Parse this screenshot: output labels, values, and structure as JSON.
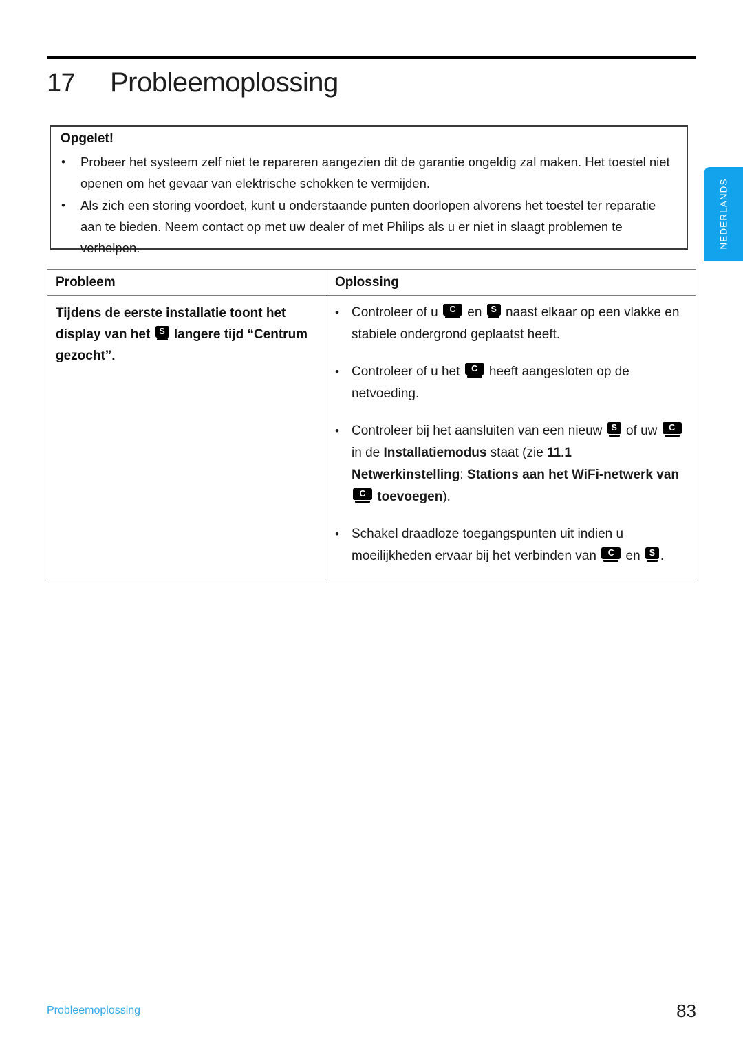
{
  "page": {
    "chapter_number": "17",
    "chapter_title": "Probleemoplossing",
    "footer_left": "Probleemoplossing",
    "footer_page": "83",
    "side_tab_label": "NEDERLANDS",
    "accent_color": "#12A3EC",
    "footer_link_color": "#36A9E8"
  },
  "caution": {
    "title": "Opgelet!",
    "bullet": "•",
    "items": [
      "Probeer het systeem zelf niet te repareren aangezien dit de garantie ongeldig zal maken. Het toestel niet openen om het gevaar van elektrische schokken te vermijden.",
      "Als zich een storing voordoet, kunt u onderstaande punten doorlopen alvorens het toestel ter reparatie aan te bieden. Neem contact op met uw dealer of met Philips als u er niet in slaagt problemen te verhelpen."
    ]
  },
  "table": {
    "headers": {
      "problem": "Probleem",
      "solution": "Oplossing"
    },
    "bullet": "•",
    "rows": [
      {
        "problem": {
          "part1": "Tijdens de eerste installatie toont het display van het ",
          "icon1": "S",
          "part2": " langere tijd “Centrum gezocht”."
        },
        "solution_items": [
          {
            "segments": [
              {
                "text": "Controleer of u "
              },
              {
                "icon": "C"
              },
              {
                "text": " en "
              },
              {
                "icon": "S"
              },
              {
                "text": " naast elkaar op een vlakke en stabiele ondergrond geplaatst heeft."
              }
            ]
          },
          {
            "segments": [
              {
                "text": "Controleer of u het "
              },
              {
                "icon": "C"
              },
              {
                "text": " heeft aangesloten op de netvoeding."
              }
            ]
          },
          {
            "segments": [
              {
                "text": "Controleer bij het aansluiten van een nieuw "
              },
              {
                "icon": "S"
              },
              {
                "text": " of uw "
              },
              {
                "icon": "C"
              },
              {
                "text": " in de "
              },
              {
                "text": "Installatiemodus",
                "bold": true
              },
              {
                "text": " staat (zie "
              },
              {
                "text": "11.1 Netwerkinstelling",
                "bold": true
              },
              {
                "text": ": ",
                "bold": false
              },
              {
                "text": "Stations aan het WiFi-netwerk van ",
                "bold": true
              },
              {
                "icon": "C",
                "bold": true
              },
              {
                "text": " toevoegen",
                "bold": true
              },
              {
                "text": ")."
              }
            ]
          },
          {
            "segments": [
              {
                "text": "Schakel draadloze toegangspunten uit indien u moeilijkheden ervaar bij het verbinden van "
              },
              {
                "icon": "C"
              },
              {
                "text": " en "
              },
              {
                "icon": "S"
              },
              {
                "text": "."
              }
            ]
          }
        ]
      }
    ]
  },
  "icons": {
    "device_center": "center-device-icon",
    "device_station": "station-device-icon"
  }
}
